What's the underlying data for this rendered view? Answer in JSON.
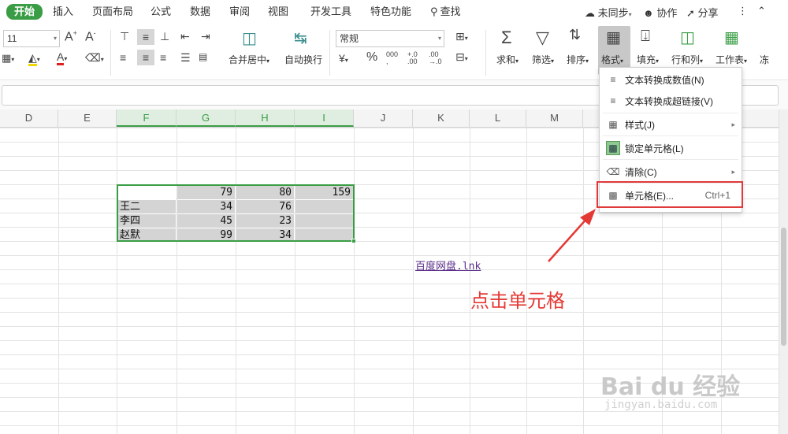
{
  "tabs": [
    "开始",
    "插入",
    "页面布局",
    "公式",
    "数据",
    "审阅",
    "视图",
    "开发工具",
    "特色功能",
    "查找"
  ],
  "topbar": {
    "sync": "未同步",
    "collab": "协作",
    "share": "分享"
  },
  "ribbon": {
    "font_size": "11",
    "number_format": "常规",
    "merge_center": "合并居中",
    "wrap_text": "自动换行",
    "sum": "求和",
    "filter": "筛选",
    "sort": "排序",
    "format": "格式",
    "fill": "填充",
    "rows_cols": "行和列",
    "worksheet": "工作表",
    "frozen": "冻"
  },
  "columns": [
    "D",
    "E",
    "F",
    "G",
    "H",
    "I",
    "J",
    "K",
    "L",
    "M"
  ],
  "selected_columns": [
    "F",
    "G",
    "H",
    "I"
  ],
  "table": {
    "r0": {
      "g": "79",
      "h": "80",
      "i": "159"
    },
    "r1": {
      "f": "王二",
      "g": "34",
      "h": "76"
    },
    "r2": {
      "f": "李四",
      "g": "45",
      "h": "23"
    },
    "r3": {
      "f": "赵默",
      "g": "99",
      "h": "34"
    }
  },
  "link_text": "百度网盘.lnk",
  "menu": {
    "items": [
      {
        "label": "文本转换成数值(N)"
      },
      {
        "label": "文本转换成超链接(V)"
      },
      {
        "label": "样式(J)"
      },
      {
        "label": "锁定单元格(L)"
      },
      {
        "label": "清除(C)"
      },
      {
        "label": "单元格(E)...",
        "shortcut": "Ctrl+1"
      }
    ]
  },
  "annotation": "点击单元格",
  "watermark": {
    "brand": "Bai du 经验",
    "url": "jingyan.baidu.com"
  },
  "colors": {
    "accent": "#3a9d45",
    "highlight": "#e03a3a",
    "annotation": "#e53935",
    "link": "#5a2d8a"
  }
}
